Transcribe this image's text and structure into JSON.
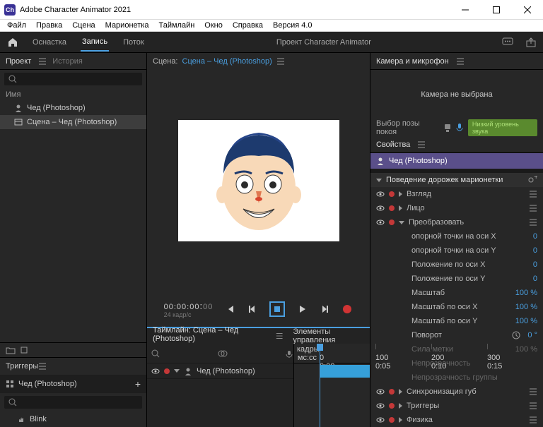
{
  "window": {
    "title": "Adobe Character Animator 2021",
    "logo_text": "Ch"
  },
  "menubar": [
    "Файл",
    "Правка",
    "Сцена",
    "Марионетка",
    "Таймлайн",
    "Окно",
    "Справка",
    "Версия 4.0"
  ],
  "tabbar": {
    "tabs": [
      "Оснастка",
      "Запись",
      "Поток"
    ],
    "active_index": 1,
    "project_label": "Проект Character Animator"
  },
  "project_panel": {
    "title": "Проект",
    "history_tab": "История",
    "name_header": "Имя",
    "items": [
      {
        "label": "Чед (Photoshop)",
        "selected": false
      },
      {
        "label": "Сцена – Чед (Photoshop)",
        "selected": true
      }
    ]
  },
  "triggers_panel": {
    "title": "Триггеры",
    "puppet": "Чед (Photoshop)",
    "items": [
      "Blink"
    ]
  },
  "scene": {
    "label": "Сцена:",
    "link": "Сцена – Чед (Photoshop)"
  },
  "transport": {
    "timecode": "00:00:00",
    "frame": "00",
    "fps": "24 кадр/с"
  },
  "timeline": {
    "title": "Таймлайн: Сцена – Чед (Photoshop)",
    "controls_tab": "Элементы управления",
    "unit1": "кадры",
    "unit2": "мс:сс",
    "ticks_f": [
      "0",
      "100",
      "200",
      "300"
    ],
    "ticks_t": [
      "0:00",
      "0:05",
      "0:10",
      "0:15"
    ],
    "track": "Чед (Photoshop)"
  },
  "camera_panel": {
    "title": "Камера и микрофон",
    "no_camera": "Камера не выбрана",
    "pose_label": "Выбор позы покоя",
    "audio_badge": "Низкий уровень звука"
  },
  "properties": {
    "title": "Свойства",
    "puppet_name": "Чед (Photoshop)",
    "behavior_header": "Поведение дорожек марионетки",
    "rows": [
      {
        "type": "item",
        "label": "Взгляд"
      },
      {
        "type": "item",
        "label": "Лицо"
      },
      {
        "type": "group",
        "label": "Преобразовать"
      },
      {
        "type": "prop",
        "label": "опорной точки на оси X",
        "value": "0",
        "cls": "val"
      },
      {
        "type": "prop",
        "label": "опорной точки на оси Y",
        "value": "0",
        "cls": "val"
      },
      {
        "type": "prop",
        "label": "Положение по оси X",
        "value": "0",
        "cls": "val"
      },
      {
        "type": "prop",
        "label": "Положение по оси Y",
        "value": "0",
        "cls": "val"
      },
      {
        "type": "prop",
        "label": "Масштаб",
        "value": "100 %",
        "cls": "val"
      },
      {
        "type": "prop",
        "label": "Масштаб по оси X",
        "value": "100 %",
        "cls": "val"
      },
      {
        "type": "prop",
        "label": "Масштаб по оси Y",
        "value": "100 %",
        "cls": "val"
      },
      {
        "type": "prop",
        "label": "Поворот",
        "value": "0 °",
        "cls": "val",
        "clock": true
      },
      {
        "type": "prop",
        "label": "Сила метки",
        "value": "100 %",
        "cls": "valg",
        "dim": true
      },
      {
        "type": "prop",
        "label": "Непрозрачность",
        "value": "",
        "cls": "valg",
        "dim": true
      },
      {
        "type": "prop",
        "label": "Непрозрачность группы",
        "value": "",
        "cls": "valg",
        "dim": true
      },
      {
        "type": "item",
        "label": "Синхронизация губ"
      },
      {
        "type": "item",
        "label": "Триггеры"
      },
      {
        "type": "item",
        "label": "Физика"
      }
    ]
  }
}
